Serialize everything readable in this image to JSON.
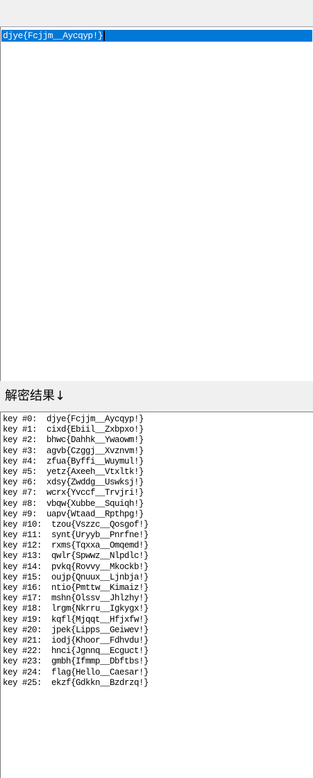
{
  "input": {
    "text": "djye{Fcjjm__Aycqyp!}"
  },
  "result_label": "解密结果↓",
  "output": {
    "lines": [
      "key #0:  djye{Fcjjm__Aycqyp!}",
      "key #1:  cixd{Ebiil__Zxbpxo!}",
      "key #2:  bhwc{Dahhk__Ywaowm!}",
      "key #3:  agvb{Czggj__Xvznvm!}",
      "key #4:  zfua{Byffi__Wuymul!}",
      "key #5:  yetz{Axeeh__Vtxltk!}",
      "key #6:  xdsy{Zwddg__Uswksj!}",
      "key #7:  wcrx{Yvccf__Trvjri!}",
      "key #8:  vbqw{Xubbe__Squiqh!}",
      "key #9:  uapv{Wtaad__Rpthpg!}",
      "key #10:  tzou{Vszzc__Qosgof!}",
      "key #11:  synt{Uryyb__Pnrfne!}",
      "key #12:  rxms{Tqxxa__Omqemd!}",
      "key #13:  qwlr{Spwwz__Nlpdlc!}",
      "key #14:  pvkq{Rovvy__Mkockb!}",
      "key #15:  oujp{Qnuux__Ljnbja!}",
      "key #16:  ntio{Pmttw__Kimaiz!}",
      "key #17:  mshn{Olssv__Jhlzhy!}",
      "key #18:  lrgm{Nkrru__Igkygx!}",
      "key #19:  kqfl{Mjqqt__Hfjxfw!}",
      "key #20:  jpek{Lipps__Geiwev!}",
      "key #21:  iodj{Khoor__Fdhvdu!}",
      "key #22:  hnci{Jgnnq__Ecguct!}",
      "key #23:  gmbh{Ifmmp__Dbftbs!}",
      "key #24:  flag{Hello__Caesar!}",
      "key #25:  ekzf{Gdkkn__Bzdrzq!}"
    ]
  }
}
